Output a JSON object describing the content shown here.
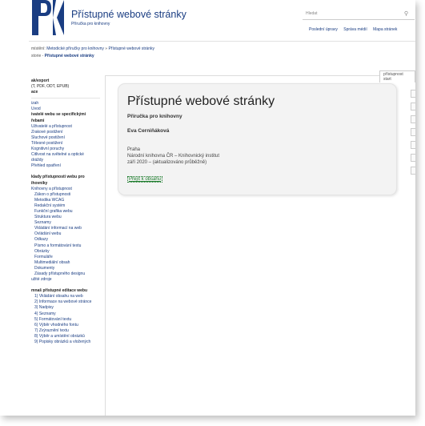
{
  "header": {
    "logo_text": "PK",
    "title": "Přístupné webové stránky",
    "subtitle": "Příručka pro knihovny",
    "search_placeholder": "Hledat",
    "links": [
      "Poslední úpravy",
      "Správa médií",
      "Mapa stránek"
    ]
  },
  "breadcrumb": {
    "prefix": "místění:",
    "items": [
      "Metodické příručky pro knihovny",
      "Přístupné webové stránky"
    ],
    "separator": "»"
  },
  "history": {
    "prefix": "storie -",
    "current": "Přístupné webové stránky"
  },
  "tab": {
    "label": "přístupnost start"
  },
  "sidebar": {
    "export": [
      "ak/export",
      "(T, PDF, ODT, EPUB)",
      "ace"
    ],
    "items": [
      {
        "label": "izah",
        "style": "link"
      },
      {
        "label": "Úvod",
        "style": "link"
      },
      {
        "label": "ivatelé webu se specifickými",
        "style": "bold"
      },
      {
        "label": "řebami",
        "style": "bold"
      },
      {
        "label": "Uživatelé a přístupnost",
        "style": "link"
      },
      {
        "label": "Zrakové postižení",
        "style": "link"
      },
      {
        "label": "Sluchové postižení",
        "style": "link"
      },
      {
        "label": "Tělesné postižení",
        "style": "link"
      },
      {
        "label": "Kognitivní poruchy",
        "style": "link"
      },
      {
        "label": "Citlivost na světelné a optické",
        "style": "link"
      },
      {
        "label": "dráždy",
        "style": "link"
      },
      {
        "label": "Přehled opatření",
        "style": "link"
      },
      {
        "label": "",
        "style": "gap"
      },
      {
        "label": "klady přístupnosti webu pro",
        "style": "bold"
      },
      {
        "label": "ihovniky",
        "style": "bold"
      },
      {
        "label": "Knihovny a přístupnost",
        "style": "link"
      },
      {
        "label": "Zákon o přístupnosti",
        "style": "indent"
      },
      {
        "label": "Metodika WCAG",
        "style": "indent"
      },
      {
        "label": "Redakční systém",
        "style": "indent"
      },
      {
        "label": "Funkční grafika webu",
        "style": "indent"
      },
      {
        "label": "Struktura webu",
        "style": "indent"
      },
      {
        "label": "Seznamy",
        "style": "indent"
      },
      {
        "label": "Vkládání informací na web",
        "style": "indent"
      },
      {
        "label": "Ovládání webu",
        "style": "indent"
      },
      {
        "label": "Odkazy",
        "style": "indent"
      },
      {
        "label": "Písmo a formátování textu",
        "style": "indent"
      },
      {
        "label": "Obrázky",
        "style": "indent"
      },
      {
        "label": "Formuláře",
        "style": "indent"
      },
      {
        "label": "Multimediální obsah",
        "style": "indent"
      },
      {
        "label": "Dokumenty",
        "style": "indent"
      },
      {
        "label": "Zásady přístupného designu",
        "style": "indent"
      },
      {
        "label": "užité zdroje",
        "style": "link"
      },
      {
        "label": "",
        "style": "gap"
      },
      {
        "label": "mnaš přístupné editace webu",
        "style": "bold"
      },
      {
        "label": "1) Vkládání obsahu na web",
        "style": "indent"
      },
      {
        "label": "2) Informace na webové stránce",
        "style": "indent"
      },
      {
        "label": "3) Nadpisy",
        "style": "indent"
      },
      {
        "label": "4) Seznamy",
        "style": "indent"
      },
      {
        "label": "5) Formátování textu",
        "style": "indent"
      },
      {
        "label": "6) Výběr vhodného fontu",
        "style": "indent"
      },
      {
        "label": "7) Zvýraznění textu",
        "style": "indent"
      },
      {
        "label": "8) Výběr a umístění obrázků",
        "style": "indent"
      },
      {
        "label": "9) Popisky obrázků a vložených",
        "style": "indent"
      }
    ]
  },
  "main": {
    "title": "Přístupné webové stránky",
    "subtitle": "Příručka pro knihovny",
    "author": "Eva Cerniňáková",
    "city": "Praha",
    "institution": "Národní knihovna ČR – Knihovnický institut",
    "date": "září 2020 – (aktualizováno průběžně)",
    "skip_link": "Přejít k obsahu"
  },
  "colors": {
    "brand": "#1a3d82",
    "link": "#1a3d82",
    "skip_link": "#1a7a2a",
    "title_box_bg": "#f3f3f3"
  }
}
